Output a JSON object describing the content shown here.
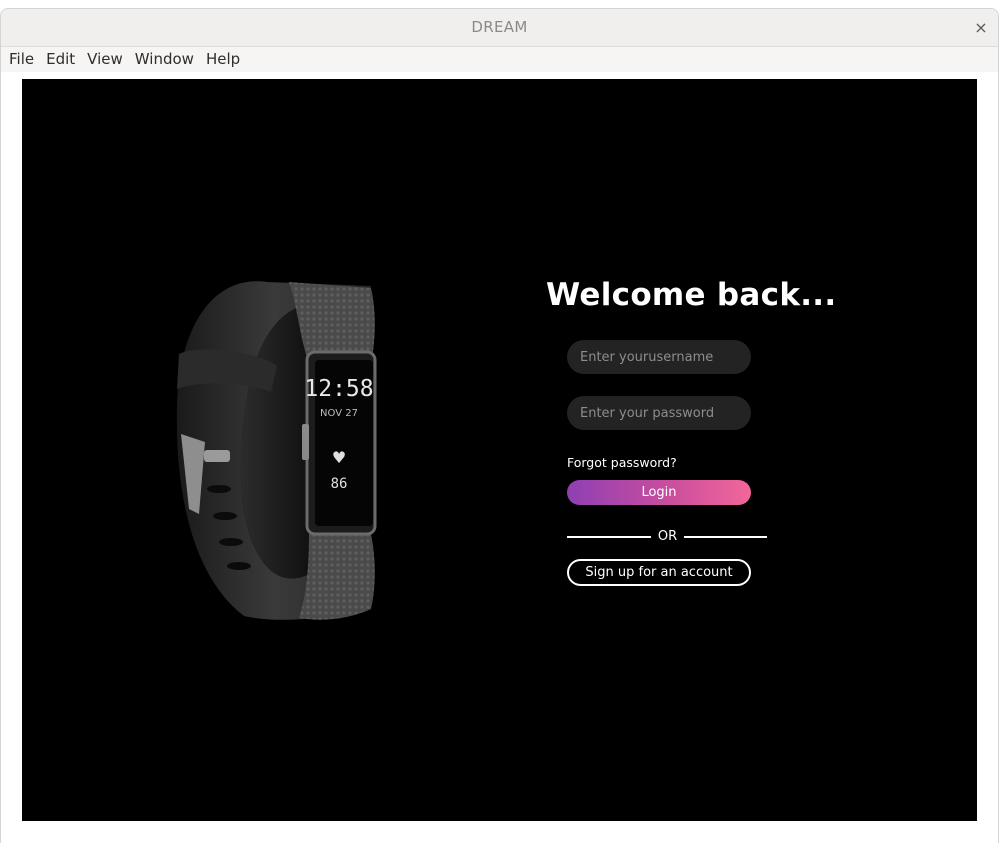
{
  "window": {
    "title": "DREAM",
    "close_symbol": "×"
  },
  "menu": [
    "File",
    "Edit",
    "View",
    "Window",
    "Help"
  ],
  "watch": {
    "time": "12:58",
    "date": "NOV 27",
    "heart_symbol": "♥",
    "heart_rate": "86"
  },
  "login": {
    "heading": "Welcome back...",
    "username_placeholder": "Enter yourusername",
    "password_placeholder": "Enter your password",
    "forgot_label": "Forgot password?",
    "login_label": "Login",
    "or_label": "OR",
    "signup_label": "Sign up for an account"
  },
  "colors": {
    "background": "#000000",
    "field_bg": "#232323",
    "gradient_start": "#8f3fb3",
    "gradient_end": "#f2679a"
  }
}
